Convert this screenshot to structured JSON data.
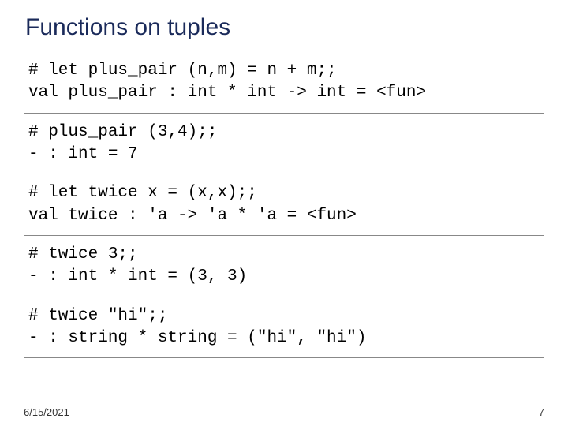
{
  "title": "Functions on tuples",
  "blocks": [
    "# let plus_pair (n,m) = n + m;;\nval plus_pair : int * int -> int = <fun>",
    "# plus_pair (3,4);;\n- : int = 7",
    "# let twice x = (x,x);;\nval twice : 'a -> 'a * 'a = <fun>",
    "# twice 3;;\n- : int * int = (3, 3)",
    "# twice \"hi\";;\n- : string * string = (\"hi\", \"hi\")"
  ],
  "footer": {
    "date": "6/15/2021",
    "page": "7"
  }
}
